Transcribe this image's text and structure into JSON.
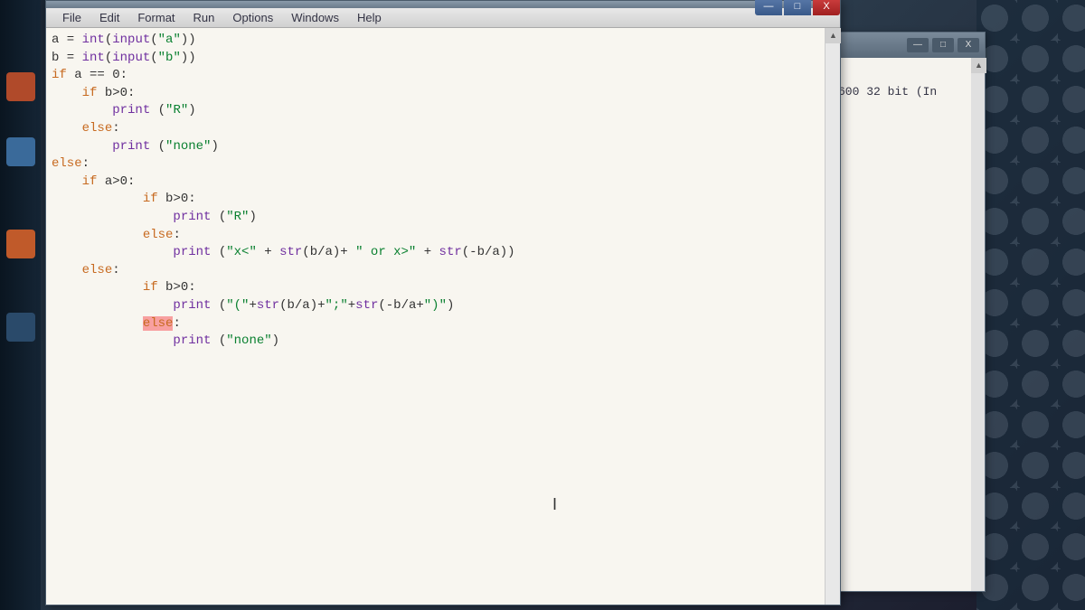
{
  "menubar": {
    "items": [
      "File",
      "Edit",
      "Format",
      "Run",
      "Options",
      "Windows",
      "Help"
    ]
  },
  "window_controls": {
    "minimize": "—",
    "maximize": "□",
    "close": "X"
  },
  "back_window": {
    "controls": {
      "minimize": "—",
      "maximize": "□",
      "close": "X"
    },
    "text": "600 32 bit (In"
  },
  "code": {
    "lines": [
      {
        "indent": 0,
        "tokens": [
          {
            "t": "op",
            "v": "a = "
          },
          {
            "t": "builtin",
            "v": "int"
          },
          {
            "t": "op",
            "v": "("
          },
          {
            "t": "builtin",
            "v": "input"
          },
          {
            "t": "op",
            "v": "("
          },
          {
            "t": "str",
            "v": "\"a\""
          },
          {
            "t": "op",
            "v": "))"
          }
        ]
      },
      {
        "indent": 0,
        "tokens": [
          {
            "t": "op",
            "v": "b = "
          },
          {
            "t": "builtin",
            "v": "int"
          },
          {
            "t": "op",
            "v": "("
          },
          {
            "t": "builtin",
            "v": "input"
          },
          {
            "t": "op",
            "v": "("
          },
          {
            "t": "str",
            "v": "\"b\""
          },
          {
            "t": "op",
            "v": "))"
          }
        ]
      },
      {
        "indent": 0,
        "tokens": [
          {
            "t": "kw",
            "v": "if"
          },
          {
            "t": "op",
            "v": " a == "
          },
          {
            "t": "op",
            "v": "0"
          },
          {
            "t": "op",
            "v": ":"
          }
        ]
      },
      {
        "indent": 1,
        "tokens": [
          {
            "t": "kw",
            "v": "if"
          },
          {
            "t": "op",
            "v": " b>"
          },
          {
            "t": "op",
            "v": "0"
          },
          {
            "t": "op",
            "v": ":"
          }
        ]
      },
      {
        "indent": 2,
        "tokens": [
          {
            "t": "builtin",
            "v": "print"
          },
          {
            "t": "op",
            "v": " ("
          },
          {
            "t": "str",
            "v": "\"R\""
          },
          {
            "t": "op",
            "v": ")"
          }
        ]
      },
      {
        "indent": 1,
        "tokens": [
          {
            "t": "kw",
            "v": "else"
          },
          {
            "t": "op",
            "v": ":"
          }
        ]
      },
      {
        "indent": 2,
        "tokens": [
          {
            "t": "builtin",
            "v": "print"
          },
          {
            "t": "op",
            "v": " ("
          },
          {
            "t": "str",
            "v": "\"none\""
          },
          {
            "t": "op",
            "v": ")"
          }
        ]
      },
      {
        "indent": 0,
        "tokens": [
          {
            "t": "kw",
            "v": "else"
          },
          {
            "t": "op",
            "v": ":"
          }
        ]
      },
      {
        "indent": 1,
        "tokens": [
          {
            "t": "kw",
            "v": "if"
          },
          {
            "t": "op",
            "v": " a>"
          },
          {
            "t": "op",
            "v": "0"
          },
          {
            "t": "op",
            "v": ":"
          }
        ]
      },
      {
        "indent": 3,
        "tokens": [
          {
            "t": "kw",
            "v": "if"
          },
          {
            "t": "op",
            "v": " b>"
          },
          {
            "t": "op",
            "v": "0"
          },
          {
            "t": "op",
            "v": ":"
          }
        ]
      },
      {
        "indent": 4,
        "tokens": [
          {
            "t": "builtin",
            "v": "print"
          },
          {
            "t": "op",
            "v": " ("
          },
          {
            "t": "str",
            "v": "\"R\""
          },
          {
            "t": "op",
            "v": ")"
          }
        ]
      },
      {
        "indent": 3,
        "tokens": [
          {
            "t": "kw",
            "v": "else"
          },
          {
            "t": "op",
            "v": ":"
          }
        ]
      },
      {
        "indent": 4,
        "tokens": [
          {
            "t": "builtin",
            "v": "print"
          },
          {
            "t": "op",
            "v": " ("
          },
          {
            "t": "str",
            "v": "\"x<\""
          },
          {
            "t": "op",
            "v": " + "
          },
          {
            "t": "builtin",
            "v": "str"
          },
          {
            "t": "op",
            "v": "(b/a)+ "
          },
          {
            "t": "str",
            "v": "\" or x>\""
          },
          {
            "t": "op",
            "v": " + "
          },
          {
            "t": "builtin",
            "v": "str"
          },
          {
            "t": "op",
            "v": "(-b/a))"
          }
        ]
      },
      {
        "indent": 1,
        "tokens": [
          {
            "t": "kw",
            "v": "else"
          },
          {
            "t": "op",
            "v": ":"
          }
        ]
      },
      {
        "indent": 3,
        "tokens": [
          {
            "t": "kw",
            "v": "if"
          },
          {
            "t": "op",
            "v": " b>"
          },
          {
            "t": "op",
            "v": "0"
          },
          {
            "t": "op",
            "v": ":"
          }
        ]
      },
      {
        "indent": 4,
        "tokens": [
          {
            "t": "builtin",
            "v": "print"
          },
          {
            "t": "op",
            "v": " ("
          },
          {
            "t": "str",
            "v": "\"(\""
          },
          {
            "t": "op",
            "v": "+"
          },
          {
            "t": "builtin",
            "v": "str"
          },
          {
            "t": "op",
            "v": "(b/a)+"
          },
          {
            "t": "str",
            "v": "\";\""
          },
          {
            "t": "op",
            "v": "+"
          },
          {
            "t": "builtin",
            "v": "str"
          },
          {
            "t": "op",
            "v": "(-b/a+"
          },
          {
            "t": "str",
            "v": "\")\""
          },
          {
            "t": "op",
            "v": ")"
          }
        ]
      },
      {
        "indent": 3,
        "tokens": [
          {
            "t": "err-hl kw",
            "v": "else"
          },
          {
            "t": "op",
            "v": ":"
          }
        ]
      },
      {
        "indent": 4,
        "tokens": [
          {
            "t": "builtin",
            "v": "print"
          },
          {
            "t": "op",
            "v": " ("
          },
          {
            "t": "str",
            "v": "\"none\""
          },
          {
            "t": "op",
            "v": ")"
          }
        ]
      }
    ]
  },
  "indent_unit": "    "
}
